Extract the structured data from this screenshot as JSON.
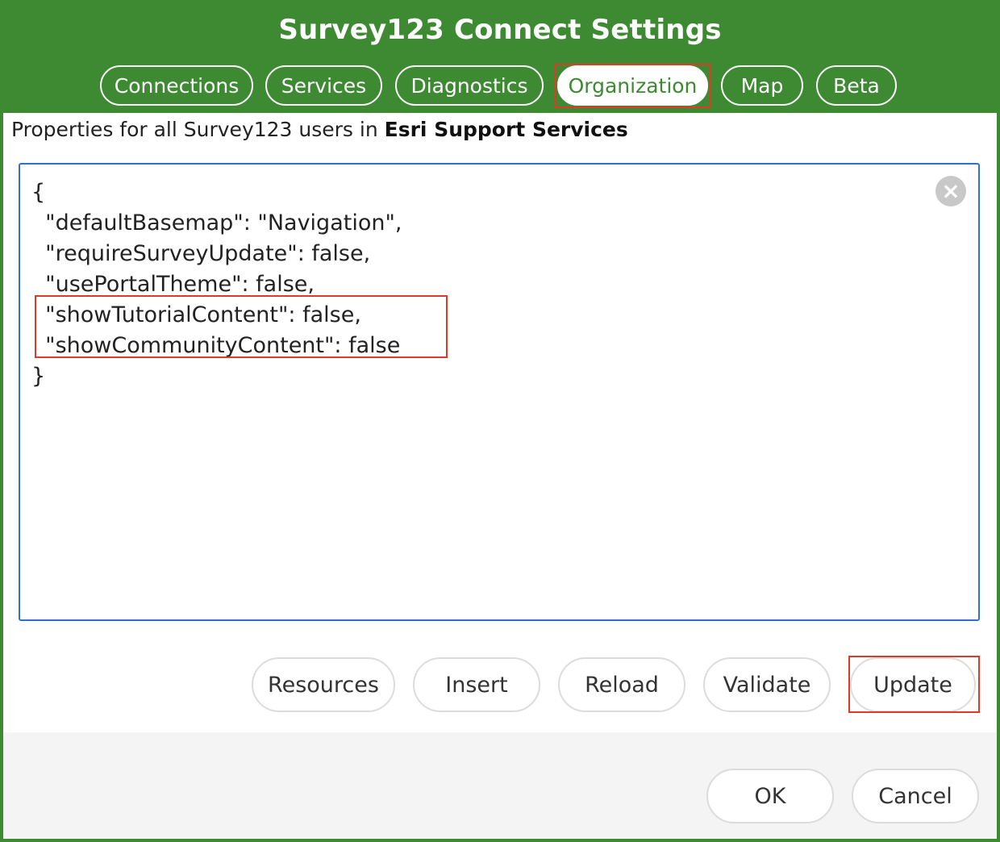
{
  "window": {
    "title": "Survey123 Connect Settings"
  },
  "tabs": [
    {
      "label": "Connections",
      "active": false
    },
    {
      "label": "Services",
      "active": false
    },
    {
      "label": "Diagnostics",
      "active": false
    },
    {
      "label": "Organization",
      "active": true
    },
    {
      "label": "Map",
      "active": false
    },
    {
      "label": "Beta",
      "active": false
    }
  ],
  "organization": {
    "properties_prefix": "Properties for all Survey123 users in ",
    "org_name": "Esri Support Services",
    "json_lines": [
      "{",
      "  \"defaultBasemap\": \"Navigation\",",
      "  \"requireSurveyUpdate\": false,",
      "  \"usePortalTheme\": false,",
      "  \"showTutorialContent\": false,",
      "  \"showCommunityContent\": false",
      "}"
    ],
    "clear_icon": "close-circle-icon"
  },
  "actions": {
    "resources": "Resources",
    "insert": "Insert",
    "reload": "Reload",
    "validate": "Validate",
    "update": "Update"
  },
  "dialog_buttons": {
    "ok": "OK",
    "cancel": "Cancel"
  },
  "colors": {
    "brand_green": "#3d8a33",
    "editor_border": "#2f6fd6",
    "highlight_red": "#e03a26"
  }
}
